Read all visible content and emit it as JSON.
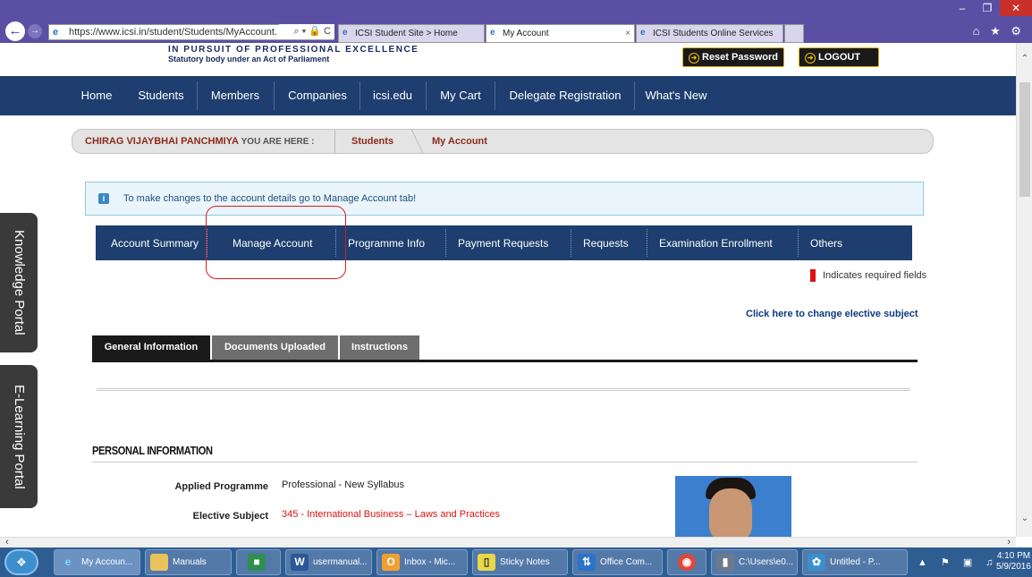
{
  "browser": {
    "address": "https://www.icsi.in/student/Students/MyAccount.",
    "address_tools": "⌕ ▾ 🔒 C",
    "tabs": [
      {
        "label": "ICSI Student Site > Home",
        "active": false
      },
      {
        "label": "My Account",
        "active": true
      },
      {
        "label": "ICSI Students Online Services",
        "active": false
      }
    ],
    "tab_close": "×",
    "right_icons": "⌂ ★ ⚙",
    "window_buttons": {
      "minimize": "–",
      "maximize": "❐",
      "close": "✕"
    }
  },
  "header": {
    "tagline": "IN PURSUIT OF PROFESSIONAL EXCELLENCE",
    "subtagline": "Statutory body under an Act of Parliament",
    "reset_password": "Reset Password",
    "logout": "LOGOUT"
  },
  "nav": [
    "Home",
    "Students",
    "Members",
    "Companies",
    "icsi.edu",
    "My Cart",
    "Delegate Registration",
    "What's New"
  ],
  "breadcrumb": {
    "user": "CHIRAG VIJAYBHAI PANCHMIYA",
    "here": "YOU ARE HERE :",
    "section": "Students",
    "current": "My Account"
  },
  "info_message": "To make changes to the account details go to Manage Account tab!",
  "account_tabs": [
    "Account Summary",
    "Manage Account",
    "Programme Info",
    "Payment Requests",
    "Requests",
    "Examination Enrollment",
    "Others"
  ],
  "required_note": "Indicates required fields",
  "elective_link": "Click here to change elective subject",
  "info_tabs": [
    "General Information",
    "Documents Uploaded",
    "Instructions"
  ],
  "section_title": "PERSONAL INFORMATION",
  "fields": [
    {
      "label": "Applied Programme",
      "value": "Professional - New Syllabus"
    },
    {
      "label": "Elective Subject",
      "value": "345 - International Business – Laws and Practices"
    }
  ],
  "side_portals": [
    "Knowledge Portal",
    "E-Learning Portal"
  ],
  "taskbar": {
    "items": [
      "My Accoun...",
      "Manuals",
      "",
      "usermanual...",
      "Inbox - Mic...",
      "Sticky Notes",
      "Office Com...",
      "",
      "C:\\Users\\e0...",
      "Untitled - P..."
    ],
    "time": "4:10 PM",
    "date": "5/9/2016"
  },
  "colors": {
    "nav_bg": "#1d3e6e",
    "title_bar": "#5b4fa3",
    "breadcrumb_text": "#8b2a1a",
    "highlight": "#d42020",
    "required_red": "#e01010"
  }
}
